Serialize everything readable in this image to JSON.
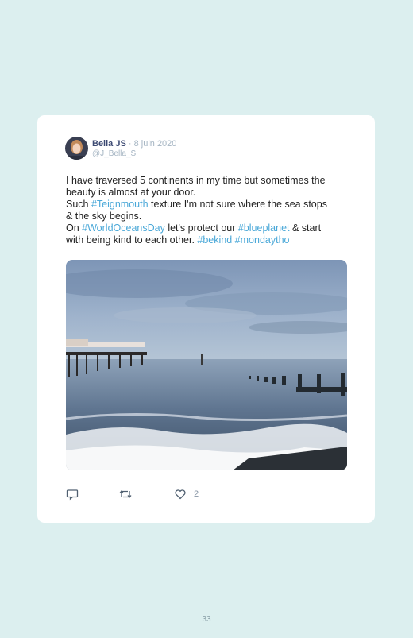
{
  "tweet": {
    "author_name": "Bella JS",
    "date": " · 8 juin 2020",
    "handle": "@J_Bella_S",
    "text": {
      "line1": "I have traversed 5 continents in my time but sometimes the",
      "line2": "beauty is almost at your door.",
      "line3_pre": "Such ",
      "line3_tag": "#Teignmouth",
      "line3_post": " texture I'm not sure where the sea stops",
      "line4": "& the sky begins.",
      "line5_pre": "On ",
      "line5_tag1": "#WorldOceansDay",
      "line5_mid": " let's protect our ",
      "line5_tag2": "#blueplanet",
      "line5_post": " & start",
      "line6_pre": "with being kind to each other. ",
      "line6_tag1": "#bekind",
      "line6_sp": " ",
      "line6_tag2": "#mondaytho"
    },
    "likes": "2"
  },
  "icons": {
    "reply": "reply-icon",
    "retweet": "retweet-icon",
    "like": "heart-icon"
  },
  "colors": {
    "background": "#dcefef",
    "hashtag": "#4aa8d8",
    "name": "#3c4a73"
  },
  "page": {
    "number": "33"
  }
}
